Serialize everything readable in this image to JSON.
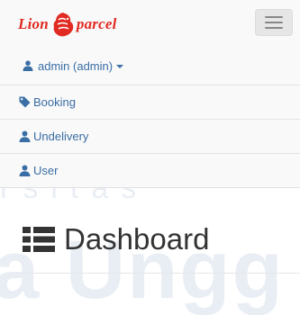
{
  "watermark": {
    "line1": "rsitas",
    "line2": "a Ungg"
  },
  "brand": {
    "word_left": "Lion",
    "word_right": "parcel",
    "color": "#e02a22"
  },
  "user_menu": {
    "label": "admin (admin)",
    "icon": "user-icon"
  },
  "nav": {
    "items": [
      {
        "label": "Booking",
        "icon": "tag-icon"
      },
      {
        "label": "Undelivery",
        "icon": "user-icon"
      },
      {
        "label": "User",
        "icon": "user-icon"
      }
    ]
  },
  "page": {
    "title": "Dashboard",
    "icon": "list-icon"
  },
  "colors": {
    "link": "#3a6ea5",
    "title": "#333333"
  }
}
